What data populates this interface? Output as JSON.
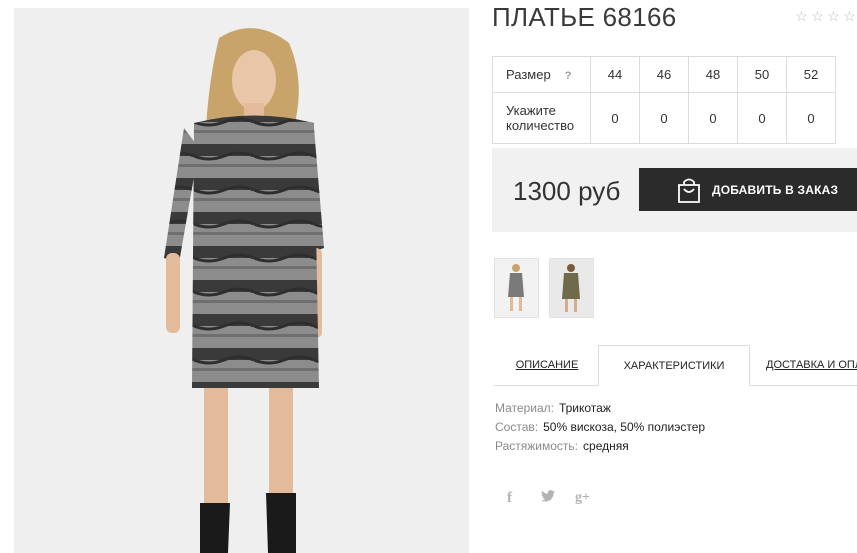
{
  "product": {
    "title": "ПЛАТЬЕ 68166",
    "rating_stars": 5,
    "rating_value": 0
  },
  "size_table": {
    "size_label": "Размер",
    "help_icon": "?",
    "qty_label": "Укажите количество",
    "sizes": [
      "44",
      "46",
      "48",
      "50",
      "52"
    ],
    "quantities": [
      "0",
      "0",
      "0",
      "0",
      "0"
    ]
  },
  "price": {
    "value": "1300 руб",
    "button_label": "ДОБАВИТЬ В ЗАКАЗ",
    "button_icon": "shopping-bag-icon"
  },
  "tabs": [
    {
      "label": "ОПИСАНИЕ",
      "active": false
    },
    {
      "label": "ХАРАКТЕРИСТИКИ",
      "active": true
    },
    {
      "label": "ДОСТАВКА И ОПЛАТА",
      "active": false
    }
  ],
  "characteristics": [
    {
      "key": "Материал:",
      "value": "Трикотаж"
    },
    {
      "key": "Состав:",
      "value": "50% вискоза, 50% полиэстер"
    },
    {
      "key": "Растяжимость:",
      "value": "средняя"
    }
  ],
  "social": {
    "facebook": "f",
    "twitter_icon": "twitter-icon",
    "google_plus": "g+"
  },
  "colors": {
    "button_bg": "#2b2b2b",
    "price_bg": "#f1f1f1",
    "border": "#dcdcdc",
    "icon_grey": "#b3b3b3"
  }
}
